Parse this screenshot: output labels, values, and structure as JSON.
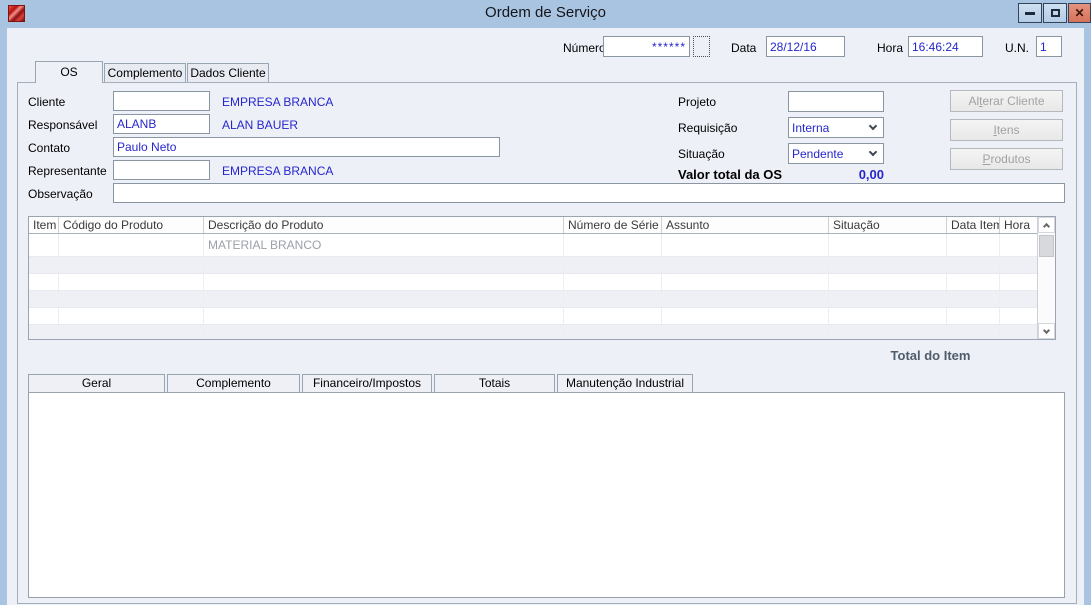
{
  "window": {
    "title": "Ordem de Serviço"
  },
  "titlebar": {
    "close_glyph": "✕"
  },
  "header": {
    "numero": {
      "label": "Número",
      "value": "******"
    },
    "data": {
      "label": "Data",
      "value": "28/12/16"
    },
    "hora": {
      "label": "Hora",
      "value": "16:46:24"
    },
    "un": {
      "label": "U.N.",
      "value": "1"
    }
  },
  "tabs": {
    "os": "OS",
    "complemento": "Complemento",
    "dados_cliente": "Dados Cliente"
  },
  "form": {
    "cliente_label": "Cliente",
    "cliente_code": "",
    "cliente_name": "EMPRESA BRANCA",
    "responsavel_label": "Responsável",
    "responsavel_code": "ALANB",
    "responsavel_name": "ALAN BAUER",
    "contato_label": "Contato",
    "contato_value": "Paulo Neto",
    "representante_label": "Representante",
    "representante_code": "",
    "representante_name": "EMPRESA BRANCA",
    "observacao_label": "Observação",
    "observacao_value": "",
    "projeto_label": "Projeto",
    "projeto_value": "",
    "requisicao_label": "Requisição",
    "requisicao_value": "Interna",
    "situacao_label": "Situação",
    "situacao_value": "Pendente",
    "valor_total_label": "Valor total da OS",
    "valor_total_value": "0,00"
  },
  "actions": {
    "alterar_cliente": {
      "pre": "Al",
      "accel": "t",
      "post": "erar Cliente"
    },
    "itens": {
      "pre": "",
      "accel": "I",
      "post": "tens"
    },
    "produtos": {
      "pre": "",
      "accel": "P",
      "post": "rodutos"
    }
  },
  "items_table": {
    "columns": [
      "Item",
      "Código do Produto",
      "Descrição do Produto",
      "Número de Série",
      "Assunto",
      "Situação",
      "Data Item",
      "Hora"
    ],
    "rows": [
      {
        "descricao": "MATERIAL BRANCO"
      },
      {},
      {},
      {},
      {},
      {}
    ]
  },
  "totals": {
    "total_item_label": "Total do Item"
  },
  "bottom_tabs": [
    "Geral",
    "Complemento",
    "Financeiro/Impostos",
    "Totais",
    "Manutenção Industrial"
  ]
}
